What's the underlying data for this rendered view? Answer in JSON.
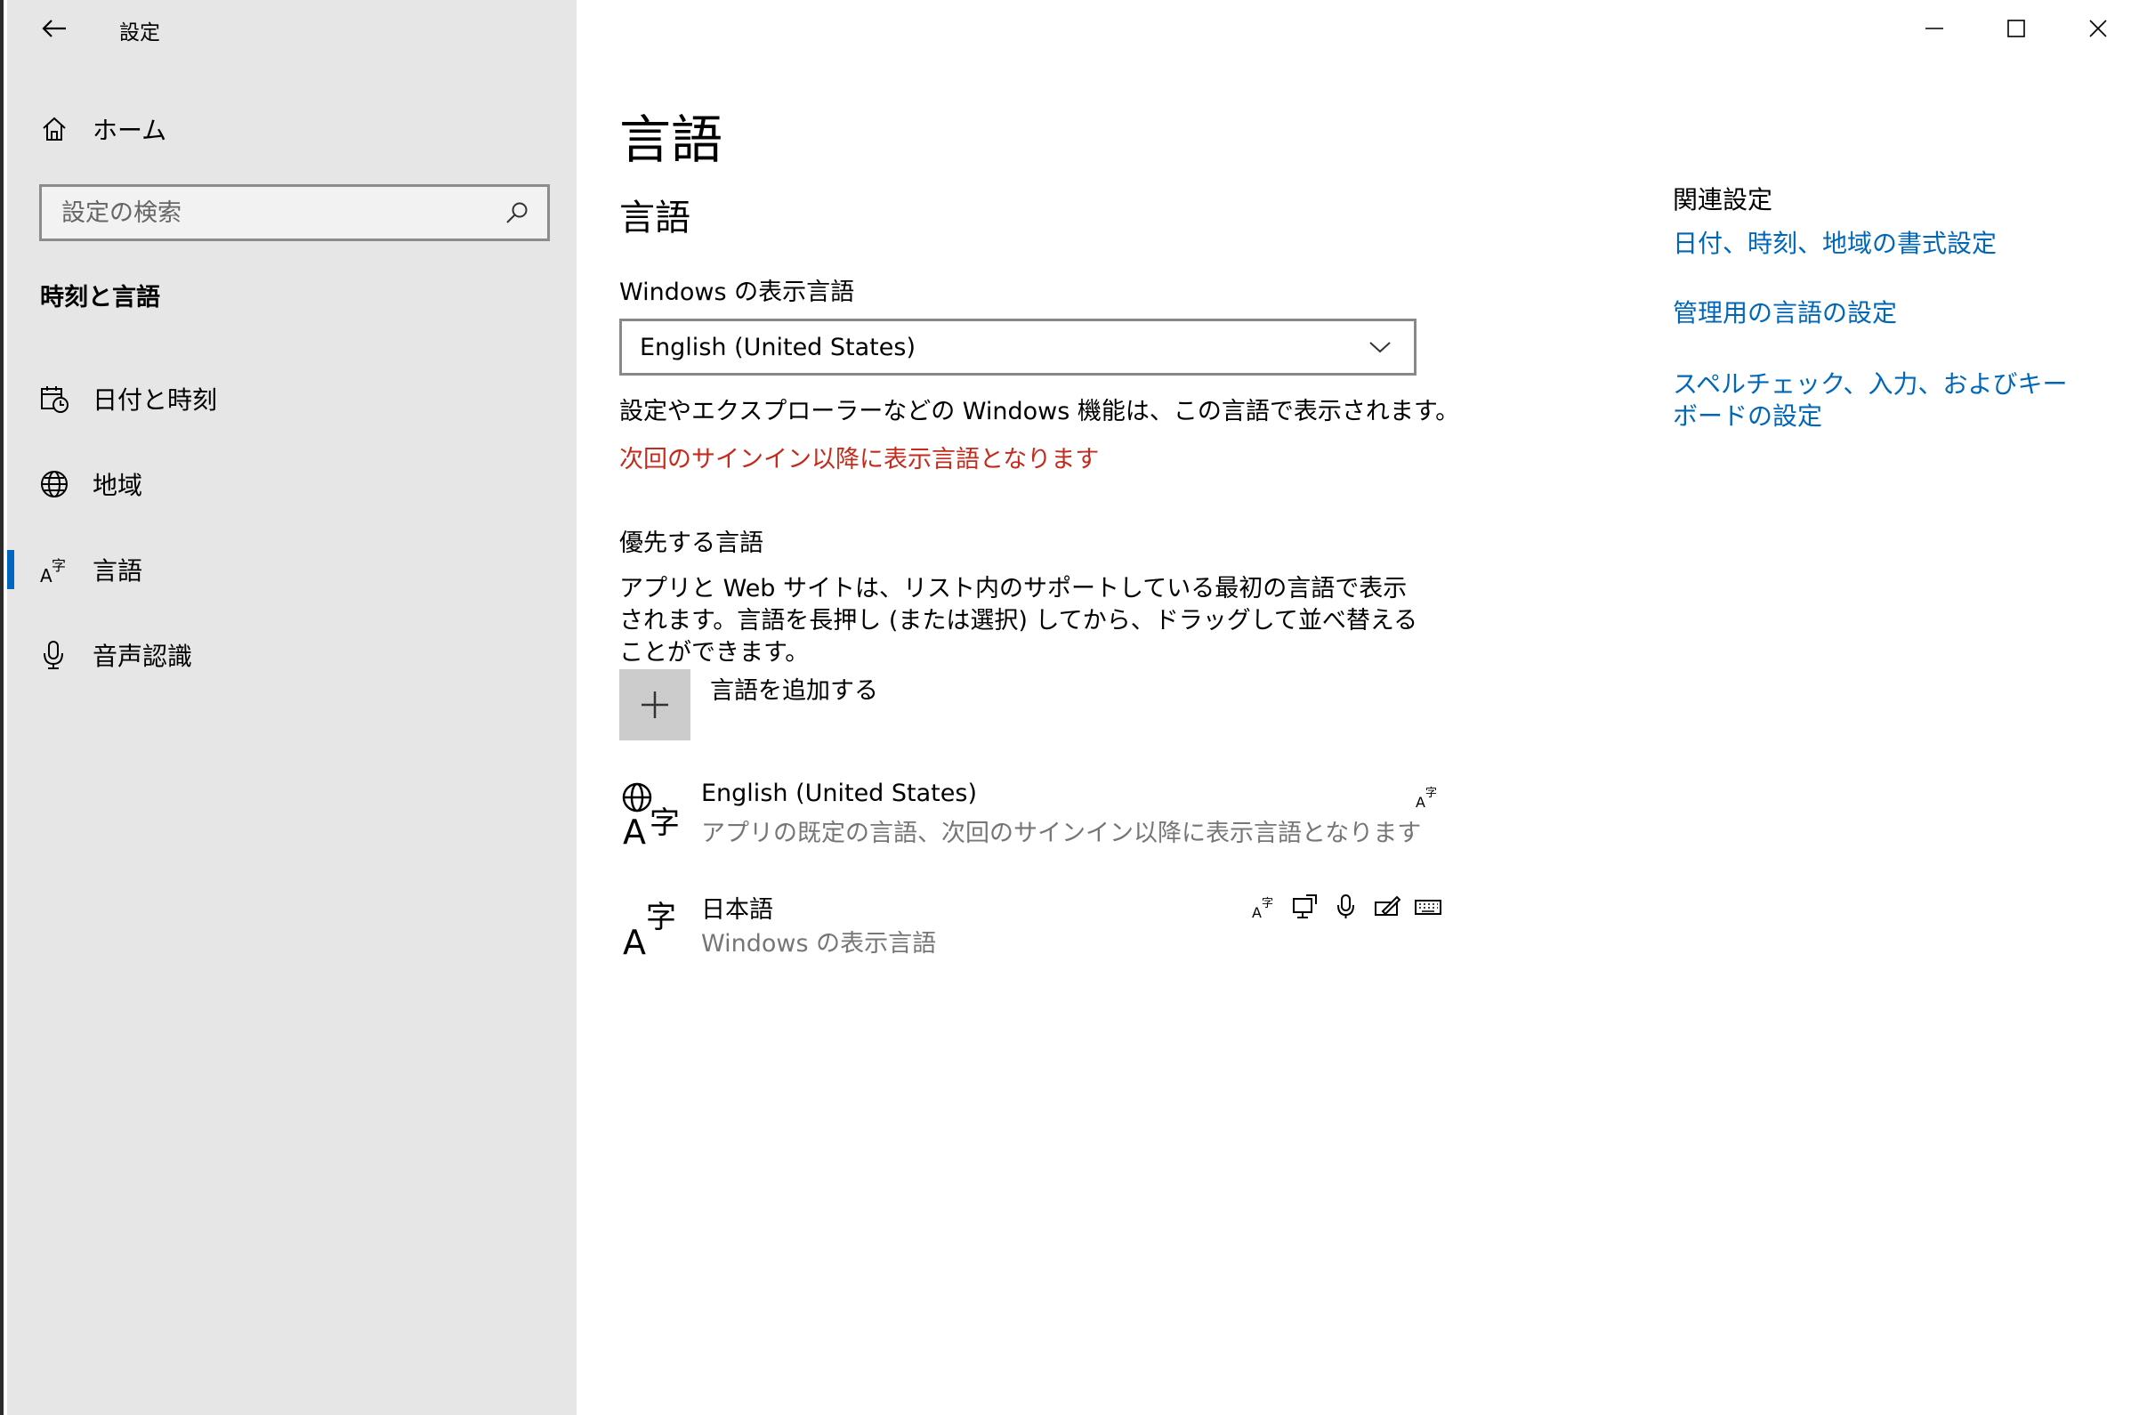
{
  "app": {
    "title": "設定"
  },
  "sidebar": {
    "home_label": "ホーム",
    "search_placeholder": "設定の検索",
    "section_title": "時刻と言語",
    "items": [
      {
        "label": "日付と時刻",
        "icon": "calendar-clock-icon"
      },
      {
        "label": "地域",
        "icon": "globe-icon"
      },
      {
        "label": "言語",
        "icon": "language-icon",
        "active": true
      },
      {
        "label": "音声認識",
        "icon": "microphone-icon"
      }
    ]
  },
  "main": {
    "page_title": "言語",
    "section_title": "言語",
    "display_lang_label": "Windows の表示言語",
    "display_lang_value": "English (United States)",
    "display_lang_note": "設定やエクスプローラーなどの Windows 機能は、この言語で表示されます。",
    "display_lang_warning": "次回のサインイン以降に表示言語となります",
    "preferred_label": "優先する言語",
    "preferred_desc": "アプリと Web サイトは、リスト内のサポートしている最初の言語で表示されます。言語を長押し (または選択) してから、ドラッグして並べ替えることができます。",
    "add_lang_label": "言語を追加する",
    "languages": [
      {
        "name": "English (United States)",
        "desc": "アプリの既定の言語、次回のサインイン以降に表示言語となります"
      },
      {
        "name": "日本語",
        "desc": "Windows の表示言語"
      }
    ]
  },
  "related": {
    "title": "関連設定",
    "links": [
      "日付、時刻、地域の書式設定",
      "管理用の言語の設定",
      "スペルチェック、入力、およびキーボードの設定"
    ]
  },
  "colors": {
    "accent": "#0067c0",
    "link": "#0067b8",
    "warning": "#c42b1c",
    "sidebar_bg": "#e6e6e6"
  }
}
